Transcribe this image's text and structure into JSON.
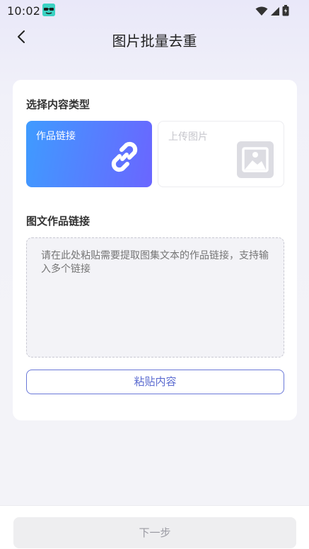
{
  "status_bar": {
    "time": "10:02",
    "app_icon": "sunglasses-app-icon",
    "icons": [
      "wifi-icon",
      "signal-icon",
      "battery-icon"
    ]
  },
  "header": {
    "title": "图片批量去重",
    "back_icon": "chevron-left-icon"
  },
  "content_type": {
    "label": "选择内容类型",
    "options": [
      {
        "label": "作品链接",
        "icon": "link-icon",
        "selected": true
      },
      {
        "label": "上传图片",
        "icon": "image-icon",
        "selected": false
      }
    ]
  },
  "link_input": {
    "label": "图文作品链接",
    "placeholder": "请在此处粘贴需要提取图集文本的作品链接，支持输入多个链接"
  },
  "paste_button": {
    "label": "粘贴内容"
  },
  "next_button": {
    "label": "下一步"
  },
  "colors": {
    "accent_start": "#3f9bff",
    "accent_end": "#6a66ff",
    "paste_border": "#6a78d8"
  }
}
